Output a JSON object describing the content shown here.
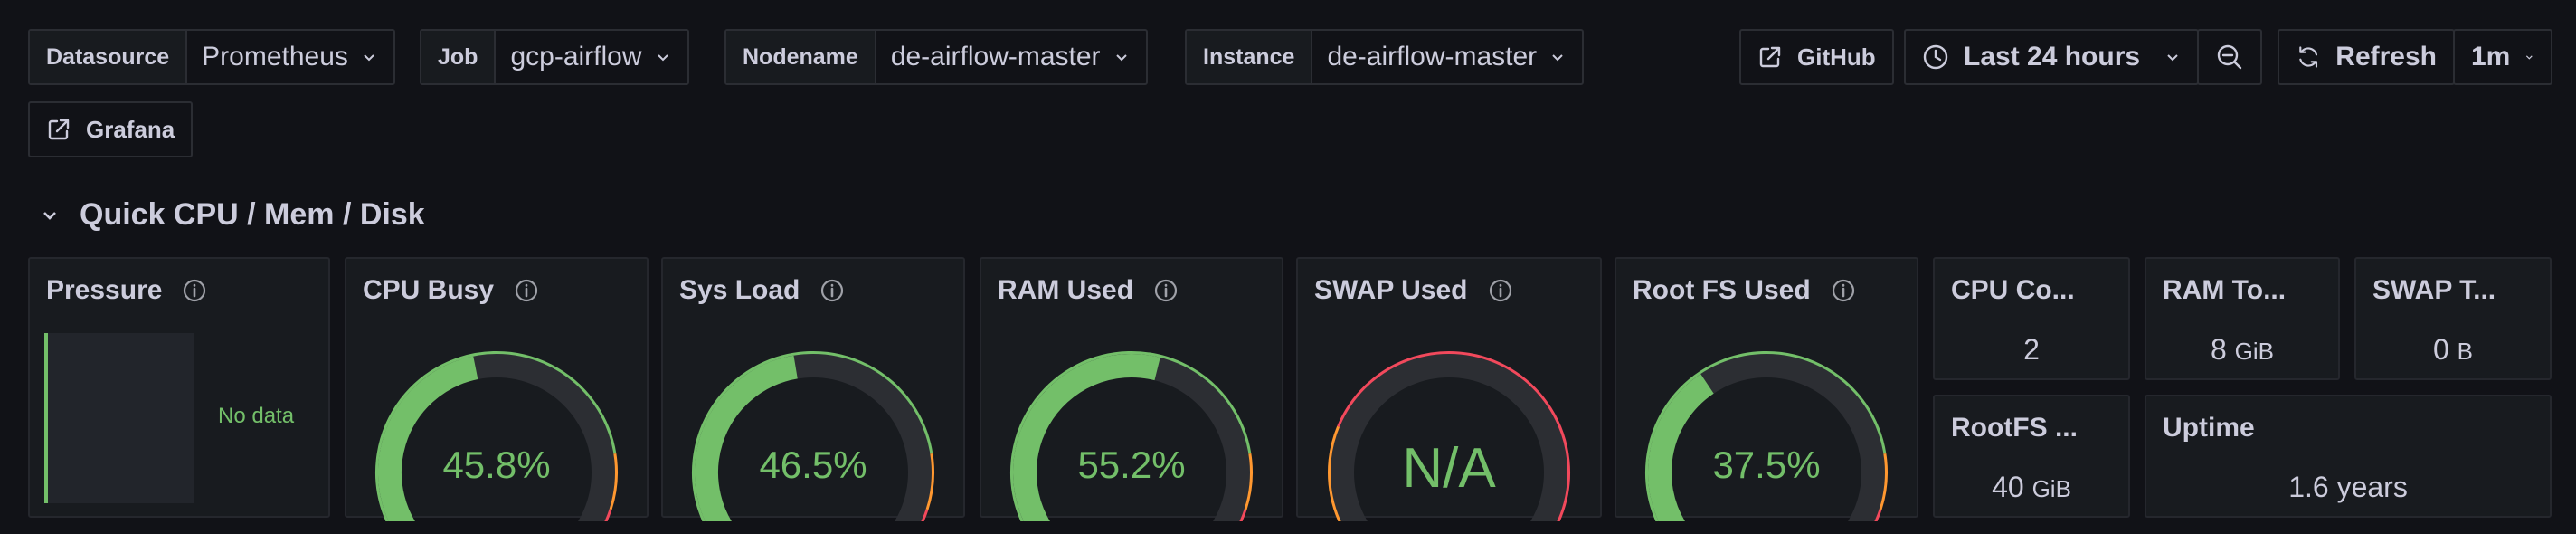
{
  "variables": [
    {
      "label": "Datasource",
      "value": "Prometheus"
    },
    {
      "label": "Job",
      "value": "gcp-airflow"
    },
    {
      "label": "Nodename",
      "value": "de-airflow-master"
    },
    {
      "label": "Instance",
      "value": "de-airflow-master"
    }
  ],
  "toolbar": {
    "github_label": "GitHub",
    "time_range": "Last 24 hours",
    "refresh_label": "Refresh",
    "refresh_interval": "1m",
    "grafana_label": "Grafana"
  },
  "row": {
    "title": "Quick CPU / Mem / Disk"
  },
  "panels": {
    "pressure": {
      "title": "Pressure",
      "no_data": "No data"
    },
    "cpu_busy": {
      "title": "CPU Busy",
      "display": "45.8%",
      "value": 45.8
    },
    "sys_load": {
      "title": "Sys Load",
      "display": "46.5%",
      "value": 46.5
    },
    "ram_used": {
      "title": "RAM Used",
      "display": "55.2%",
      "value": 55.2
    },
    "swap_used": {
      "title": "SWAP Used",
      "display": "N/A"
    },
    "root_fs_used": {
      "title": "Root FS Used",
      "display": "37.5%",
      "value": 37.5
    },
    "cpu_cores": {
      "title": "CPU Co...",
      "value": "2"
    },
    "ram_total": {
      "title": "RAM To...",
      "value": "8",
      "unit": "GiB"
    },
    "swap_total": {
      "title": "SWAP T...",
      "value": "0",
      "unit": "B"
    },
    "rootfs_total": {
      "title": "RootFS ...",
      "value": "40",
      "unit": "GiB"
    },
    "uptime": {
      "title": "Uptime",
      "value": "1.6 years"
    }
  },
  "colors": {
    "green": "#73bf69",
    "orange": "#ff9830",
    "red": "#f2495c",
    "track": "#2c2e33"
  }
}
